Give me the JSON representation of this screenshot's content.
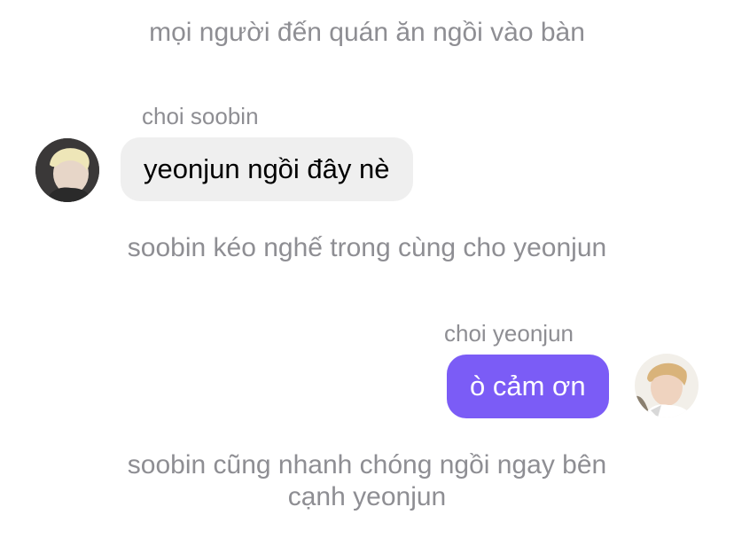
{
  "colors": {
    "outgoing_bubble": "#7b5cf6",
    "incoming_bubble": "#efefef",
    "narration_text": "#8e8e93"
  },
  "messages": [
    {
      "type": "narration",
      "text": "mọi người đến quán ăn ngồi vào bàn"
    },
    {
      "type": "incoming",
      "sender": "choi soobin",
      "text": "yeonjun ngồi đây nè",
      "avatar_icon": "user-avatar-photo"
    },
    {
      "type": "narration",
      "text": "soobin kéo nghế trong cùng cho yeonjun"
    },
    {
      "type": "outgoing",
      "sender": "choi yeonjun",
      "text": "ò cảm ơn",
      "avatar_icon": "user-avatar-photo"
    },
    {
      "type": "narration",
      "lines": [
        "soobin cũng nhanh chóng ngồi ngay bên",
        "cạnh yeonjun"
      ]
    }
  ]
}
